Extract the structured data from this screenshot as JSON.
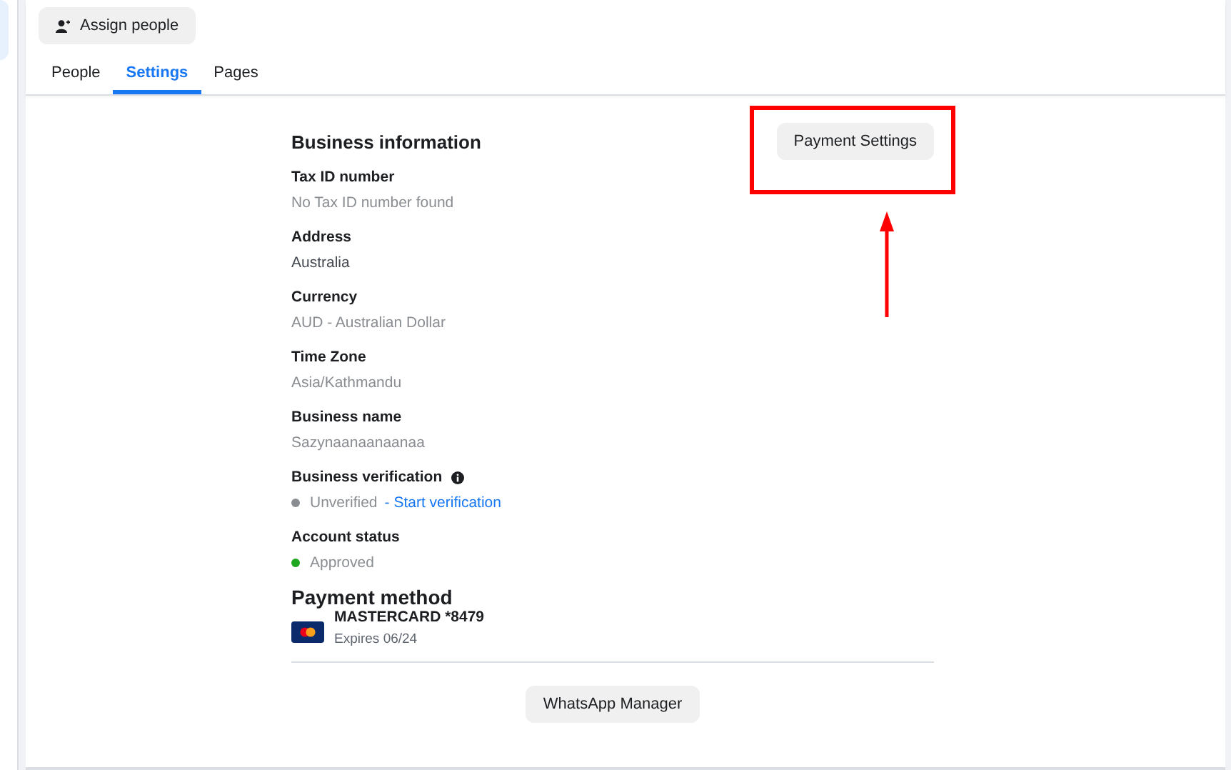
{
  "assign_button": {
    "label": "Assign people"
  },
  "tabs": [
    {
      "label": "People",
      "selected": false
    },
    {
      "label": "Settings",
      "selected": true
    },
    {
      "label": "Pages",
      "selected": false
    }
  ],
  "section_title": "Business information",
  "payment_settings_button": {
    "label": "Payment Settings",
    "highlighted": true
  },
  "fields": [
    {
      "kind": "text",
      "label": "Tax ID number",
      "value": "No Tax ID number found",
      "muted": true
    },
    {
      "kind": "text",
      "label": "Address",
      "value": "Australia",
      "muted": false
    },
    {
      "kind": "text",
      "label": "Currency",
      "value": "AUD - Australian Dollar",
      "muted": true
    },
    {
      "kind": "text",
      "label": "Time Zone",
      "value": "Asia/Kathmandu",
      "muted": true
    },
    {
      "kind": "text",
      "label": "Business name",
      "value": "Sazynaanaanaanaa",
      "muted": true
    },
    {
      "kind": "status",
      "label": "Business verification",
      "info": true,
      "value": "Unverified",
      "color": "#8a8d91",
      "link": "- Start verification"
    },
    {
      "kind": "status",
      "label": "Account status",
      "info": false,
      "value": "Approved",
      "color": "#1fa81f"
    }
  ],
  "payment_method": {
    "title": "Payment method",
    "card": "MASTERCARD *8479",
    "expires": "Expires 06/24"
  },
  "whatsapp_button": {
    "label": "WhatsApp Manager"
  }
}
